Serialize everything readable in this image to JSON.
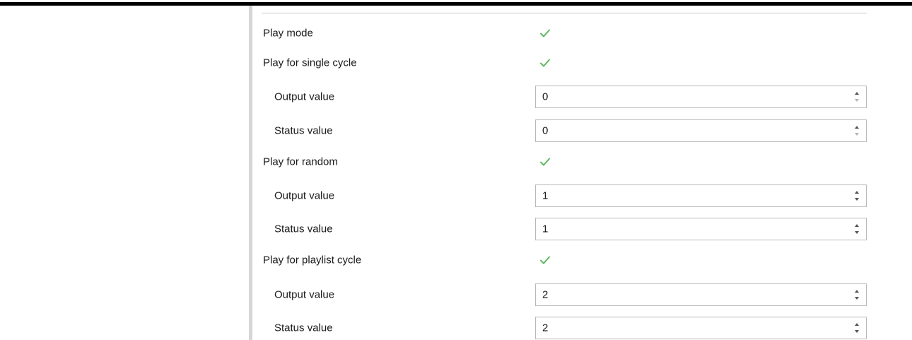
{
  "colors": {
    "check": "#5fb85f",
    "arrow_active": "#555555",
    "arrow_disabled": "#b5b5b5",
    "field_border": "#b9b9b9"
  },
  "rows": [
    {
      "label": "Play mode",
      "control": "checkbox",
      "checked": true
    },
    {
      "label": "Play for single cycle",
      "control": "checkbox",
      "checked": true
    },
    {
      "label": "Output value",
      "control": "spinbox",
      "value": "0",
      "down_disabled": true
    },
    {
      "label": "Status value",
      "control": "spinbox",
      "value": "0",
      "down_disabled": true
    },
    {
      "label": "Play for random",
      "control": "checkbox",
      "checked": true
    },
    {
      "label": "Output value",
      "control": "spinbox",
      "value": "1",
      "down_disabled": false
    },
    {
      "label": "Status value",
      "control": "spinbox",
      "value": "1",
      "down_disabled": false
    },
    {
      "label": "Play for playlist cycle",
      "control": "checkbox",
      "checked": true
    },
    {
      "label": "Output value",
      "control": "spinbox",
      "value": "2",
      "down_disabled": false
    },
    {
      "label": "Status value",
      "control": "spinbox",
      "value": "2",
      "down_disabled": false
    }
  ]
}
